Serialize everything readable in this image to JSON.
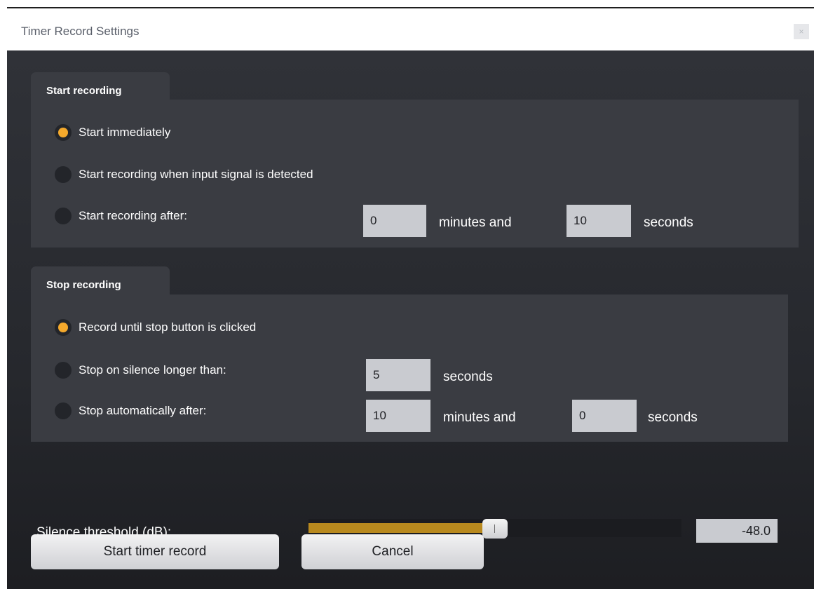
{
  "window": {
    "title": "Timer Record Settings",
    "close_glyph": "×"
  },
  "start_group": {
    "title": "Start recording",
    "options": [
      {
        "label": "Start immediately",
        "checked": true
      },
      {
        "label": "Start recording when input signal is detected",
        "checked": false
      },
      {
        "label": "Start recording after:",
        "checked": false
      }
    ],
    "after_minutes": "0",
    "minutes_label": "minutes and",
    "after_seconds": "10",
    "seconds_label": "seconds"
  },
  "stop_group": {
    "title": "Stop recording",
    "options": [
      {
        "label": "Record until stop button is clicked",
        "checked": true
      },
      {
        "label": "Stop on silence longer than:",
        "checked": false
      },
      {
        "label": "Stop automatically after:",
        "checked": false
      }
    ],
    "silence_seconds": "5",
    "silence_seconds_label": "seconds",
    "auto_minutes": "10",
    "minutes_label": "minutes and",
    "auto_seconds": "0",
    "seconds_label": "seconds"
  },
  "threshold": {
    "label": "Silence threshold (dB):",
    "value": "-48.0",
    "slider_fraction": 0.5
  },
  "buttons": {
    "start": "Start timer record",
    "cancel": "Cancel"
  },
  "colors": {
    "accent": "#f4a92c",
    "slider_fill": "#b8891e"
  }
}
